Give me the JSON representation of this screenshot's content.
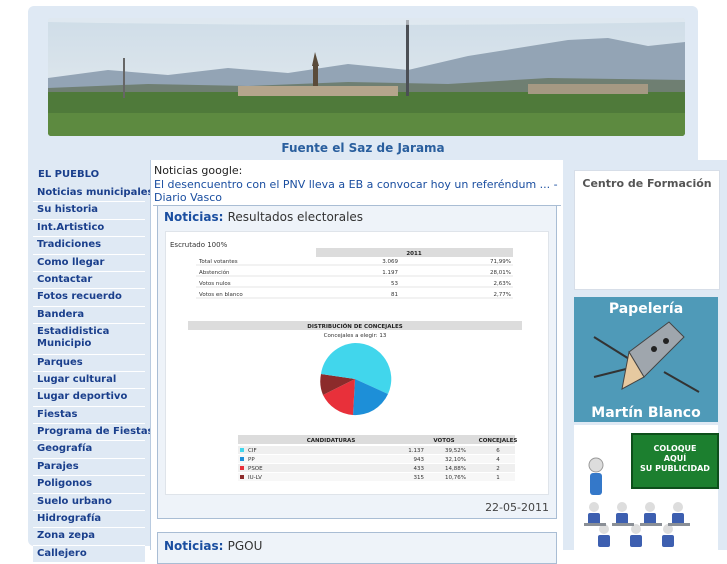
{
  "site": {
    "title": "Fuente el Saz de Jarama"
  },
  "sidebar": {
    "heading": "EL PUEBLO",
    "items": [
      "Noticias municipales",
      "Su historia",
      "Int.Artistico",
      "Tradiciones",
      "Como llegar",
      "Contactar",
      "Fotos recuerdo",
      "Bandera",
      "Estadidistica Municipio",
      "Parques",
      "Lugar cultural",
      "Lugar deportivo",
      "Fiestas",
      "Programa de Fiestas",
      "Geografía",
      "Parajes",
      "Poligonos",
      "Suelo urbano",
      "Hidrografía",
      "Zona zepa",
      "Callejero"
    ]
  },
  "google_news": {
    "label": "Noticias google:",
    "headline": "El desencuentro con el PNV lleva a EB a convocar hoy un referéndum ... - Diario Vasco"
  },
  "news": [
    {
      "label": "Noticias",
      "sep": ": ",
      "title": "Resultados electorales",
      "date": "22-05-2011",
      "results_image": {
        "escrutado": "Escrutado 100%",
        "year": "2011",
        "rows": [
          {
            "label": "Total votantes",
            "count": "3.069",
            "pct": "71,99%"
          },
          {
            "label": "Abstención",
            "count": "1.197",
            "pct": "28,01%"
          },
          {
            "label": "Votos nulos",
            "count": "53",
            "pct": "2,63%"
          },
          {
            "label": "Votos en blanco",
            "count": "81",
            "pct": "2,77%"
          }
        ],
        "dist_title": "DISTRIBUCIÓN DE CONCEJALES",
        "dist_sub": "Concejales a elegir: 13",
        "table_headers": [
          "CANDIDATURAS",
          "VOTOS",
          "CONCEJALES"
        ],
        "parties": [
          {
            "name": "CIF",
            "votes": "1.137",
            "pct": "39,52%",
            "seats": "6",
            "color": "#41d6ec"
          },
          {
            "name": "PP",
            "votes": "943",
            "pct": "32,10%",
            "seats": "4",
            "color": "#1d8fd8"
          },
          {
            "name": "PSOE",
            "votes": "433",
            "pct": "14,88%",
            "seats": "2",
            "color": "#e8303a"
          },
          {
            "name": "IU-LV",
            "votes": "315",
            "pct": "10,76%",
            "seats": "1",
            "color": "#8c2b2b"
          }
        ]
      }
    },
    {
      "label": "Noticias",
      "sep": ": ",
      "title": "PGOU"
    }
  ],
  "ads": {
    "training": "Centro de Formación",
    "stationery_top": "Papelería",
    "stationery_bottom": "Martín Blanco",
    "advertise": [
      "COLOQUE",
      "AQUÍ",
      "SU PUBLICIDAD"
    ]
  },
  "colors": {
    "accent": "#1a4ea0",
    "frame": "#dfe9f4",
    "title": "#2a5f9e"
  }
}
